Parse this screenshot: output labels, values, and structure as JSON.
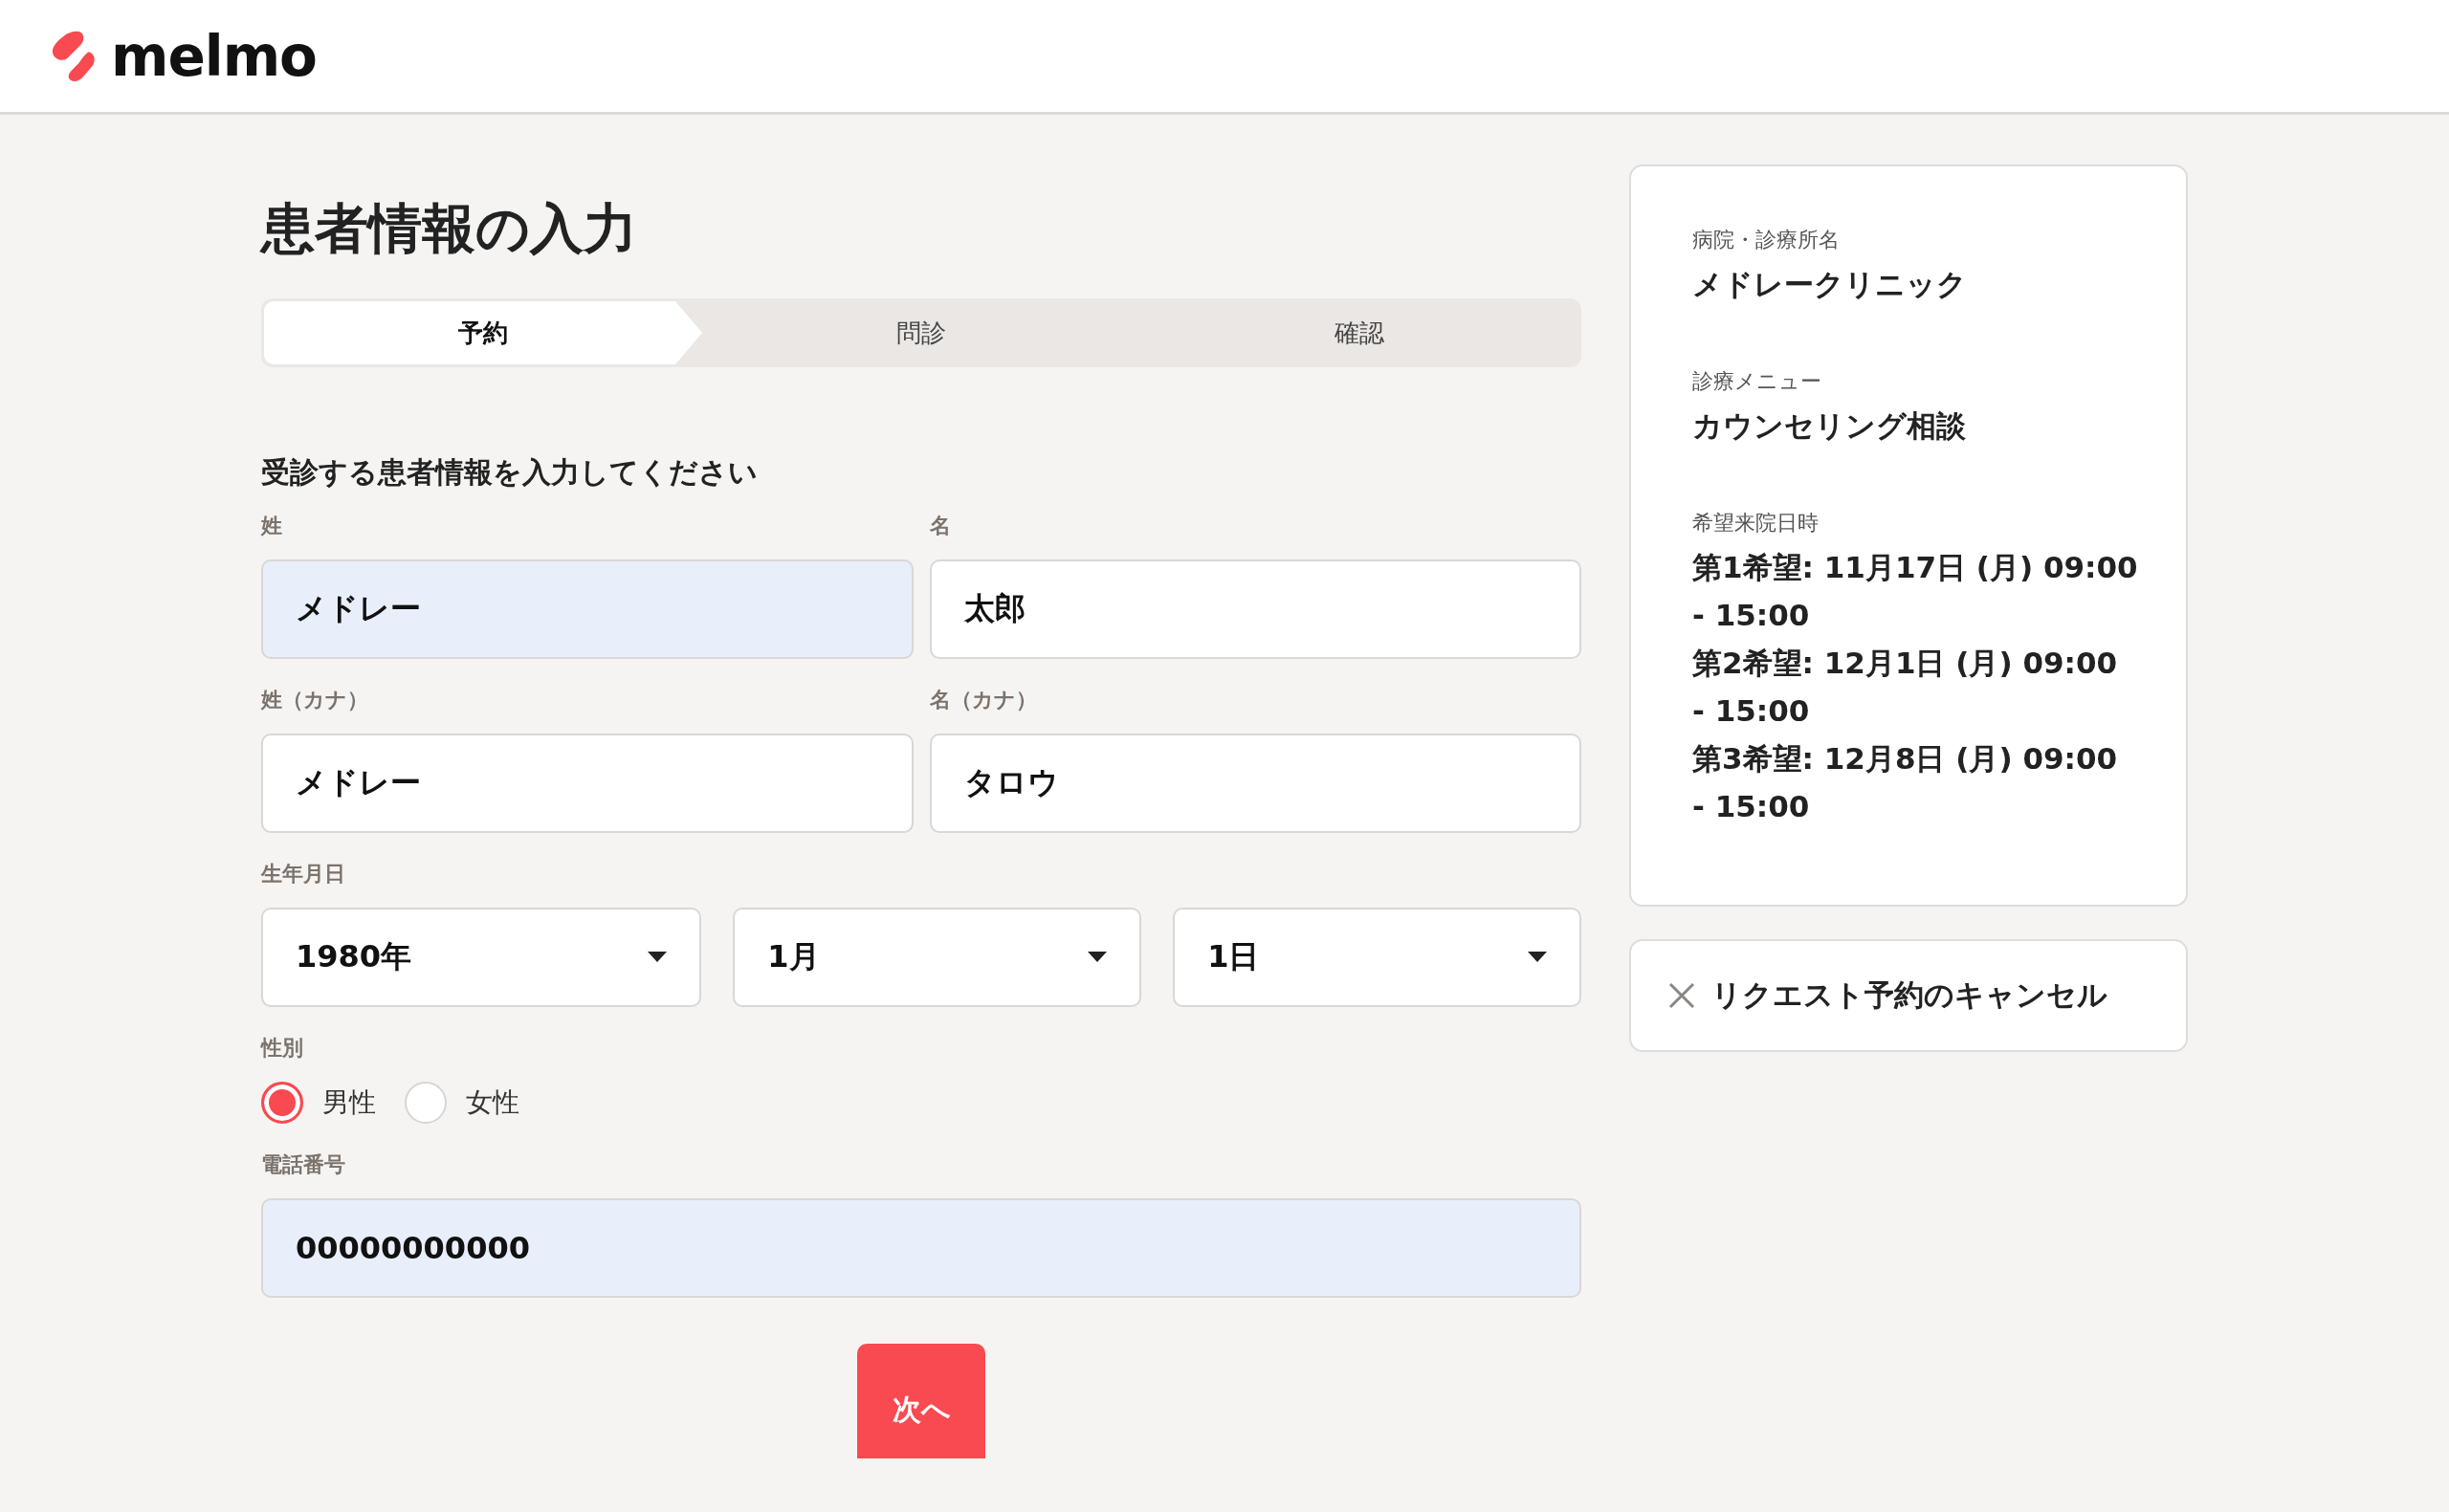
{
  "header": {
    "logo_text": "melmo"
  },
  "title": "患者情報の入力",
  "steps": [
    {
      "label": "予約",
      "selected": true
    },
    {
      "label": "問診",
      "selected": false
    },
    {
      "label": "確認",
      "selected": false
    }
  ],
  "section_heading": "受診する患者情報を入力してください",
  "name_rows": [
    [
      {
        "label": "姓",
        "value": "メドレー",
        "autofilled": true
      },
      {
        "label": "名",
        "value": "太郎",
        "autofilled": false
      }
    ],
    [
      {
        "label": "姓（カナ）",
        "value": "メドレー",
        "autofilled": false
      },
      {
        "label": "名（カナ）",
        "value": "タロウ",
        "autofilled": false
      }
    ]
  ],
  "birthdate": {
    "label": "生年月日",
    "selects": [
      "1980年",
      "1月",
      "1日"
    ]
  },
  "gender": {
    "label": "性別",
    "options": [
      {
        "label": "男性",
        "selected": true
      },
      {
        "label": "女性",
        "selected": false
      }
    ]
  },
  "phone": {
    "label": "電話番号",
    "value": "00000000000",
    "autofilled": true
  },
  "next_button": "次へ",
  "summary": {
    "items": [
      {
        "label": "病院・診療所名",
        "values": [
          "メドレークリニック"
        ]
      },
      {
        "label": "診療メニュー",
        "values": [
          "カウンセリング相談"
        ]
      },
      {
        "label": "希望来院日時",
        "values": [
          "第1希望: 11月17日 (月) 09:00 - 15:00",
          "第2希望: 12月1日 (月) 09:00 - 15:00",
          "第3希望: 12月8日 (月) 09:00 - 15:00"
        ]
      }
    ]
  },
  "cancel_button": "リクエスト予約のキャンセル"
}
